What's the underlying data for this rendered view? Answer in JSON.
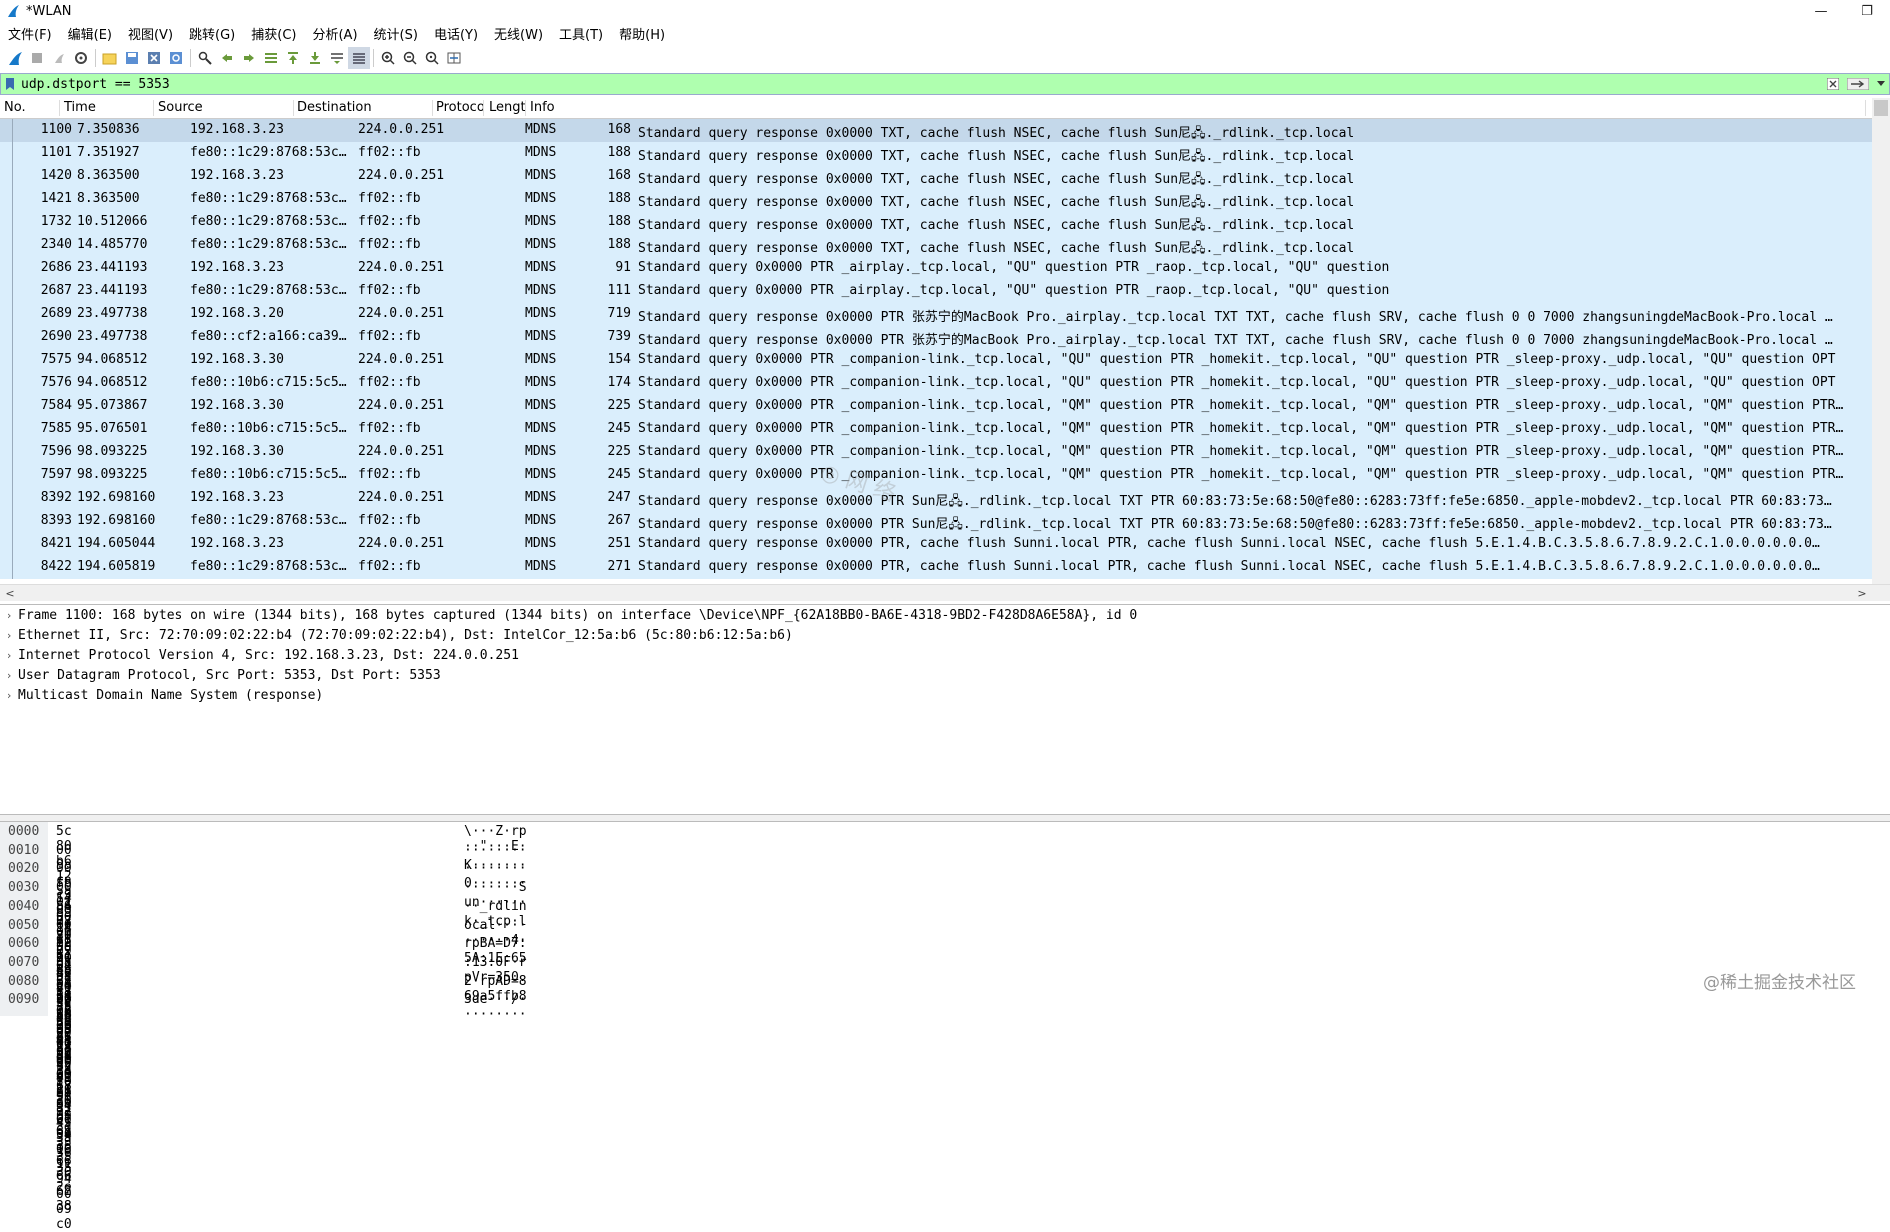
{
  "window": {
    "title": "*WLAN",
    "minimize": "—",
    "restore": "❐"
  },
  "menu": [
    "文件(F)",
    "编辑(E)",
    "视图(V)",
    "跳转(G)",
    "捕获(C)",
    "分析(A)",
    "统计(S)",
    "电话(Y)",
    "无线(W)",
    "工具(T)",
    "帮助(H)"
  ],
  "filter": {
    "value": "udp.dstport == 5353"
  },
  "columns": [
    "No.",
    "Time",
    "Source",
    "Destination",
    "Protoco",
    "Lengt",
    "Info"
  ],
  "packets": [
    {
      "no": "1100",
      "time": "7.350836",
      "src": "192.168.3.23",
      "dst": "224.0.0.251",
      "proto": "MDNS",
      "len": "168",
      "info": "Standard query response 0x0000 TXT, cache flush NSEC, cache flush Sun尼🖧._rdlink._tcp.local"
    },
    {
      "no": "1101",
      "time": "7.351927",
      "src": "fe80::1c29:8768:53c…",
      "dst": "ff02::fb",
      "proto": "MDNS",
      "len": "188",
      "info": "Standard query response 0x0000 TXT, cache flush NSEC, cache flush Sun尼🖧._rdlink._tcp.local"
    },
    {
      "no": "1420",
      "time": "8.363500",
      "src": "192.168.3.23",
      "dst": "224.0.0.251",
      "proto": "MDNS",
      "len": "168",
      "info": "Standard query response 0x0000 TXT, cache flush NSEC, cache flush Sun尼🖧._rdlink._tcp.local"
    },
    {
      "no": "1421",
      "time": "8.363500",
      "src": "fe80::1c29:8768:53c…",
      "dst": "ff02::fb",
      "proto": "MDNS",
      "len": "188",
      "info": "Standard query response 0x0000 TXT, cache flush NSEC, cache flush Sun尼🖧._rdlink._tcp.local"
    },
    {
      "no": "1732",
      "time": "10.512066",
      "src": "fe80::1c29:8768:53c…",
      "dst": "ff02::fb",
      "proto": "MDNS",
      "len": "188",
      "info": "Standard query response 0x0000 TXT, cache flush NSEC, cache flush Sun尼🖧._rdlink._tcp.local"
    },
    {
      "no": "2340",
      "time": "14.485770",
      "src": "fe80::1c29:8768:53c…",
      "dst": "ff02::fb",
      "proto": "MDNS",
      "len": "188",
      "info": "Standard query response 0x0000 TXT, cache flush NSEC, cache flush Sun尼🖧._rdlink._tcp.local"
    },
    {
      "no": "2686",
      "time": "23.441193",
      "src": "192.168.3.23",
      "dst": "224.0.0.251",
      "proto": "MDNS",
      "len": "91",
      "info": "Standard query 0x0000 PTR _airplay._tcp.local, \"QU\" question PTR _raop._tcp.local, \"QU\" question"
    },
    {
      "no": "2687",
      "time": "23.441193",
      "src": "fe80::1c29:8768:53c…",
      "dst": "ff02::fb",
      "proto": "MDNS",
      "len": "111",
      "info": "Standard query 0x0000 PTR _airplay._tcp.local, \"QU\" question PTR _raop._tcp.local, \"QU\" question"
    },
    {
      "no": "2689",
      "time": "23.497738",
      "src": "192.168.3.20",
      "dst": "224.0.0.251",
      "proto": "MDNS",
      "len": "719",
      "info": "Standard query response 0x0000 PTR 张苏宁的MacBook Pro._airplay._tcp.local TXT TXT, cache flush SRV, cache flush 0 0 7000 zhangsuningdeMacBook-Pro.local …"
    },
    {
      "no": "2690",
      "time": "23.497738",
      "src": "fe80::cf2:a166:ca39…",
      "dst": "ff02::fb",
      "proto": "MDNS",
      "len": "739",
      "info": "Standard query response 0x0000 PTR 张苏宁的MacBook Pro._airplay._tcp.local TXT TXT, cache flush SRV, cache flush 0 0 7000 zhangsuningdeMacBook-Pro.local …"
    },
    {
      "no": "7575",
      "time": "94.068512",
      "src": "192.168.3.30",
      "dst": "224.0.0.251",
      "proto": "MDNS",
      "len": "154",
      "info": "Standard query 0x0000 PTR _companion-link._tcp.local, \"QU\" question PTR _homekit._tcp.local, \"QU\" question PTR _sleep-proxy._udp.local, \"QU\" question OPT"
    },
    {
      "no": "7576",
      "time": "94.068512",
      "src": "fe80::10b6:c715:5c5…",
      "dst": "ff02::fb",
      "proto": "MDNS",
      "len": "174",
      "info": "Standard query 0x0000 PTR _companion-link._tcp.local, \"QU\" question PTR _homekit._tcp.local, \"QU\" question PTR _sleep-proxy._udp.local, \"QU\" question OPT"
    },
    {
      "no": "7584",
      "time": "95.073867",
      "src": "192.168.3.30",
      "dst": "224.0.0.251",
      "proto": "MDNS",
      "len": "225",
      "info": "Standard query 0x0000 PTR _companion-link._tcp.local, \"QM\" question PTR _homekit._tcp.local, \"QM\" question PTR _sleep-proxy._udp.local, \"QM\" question PTR…"
    },
    {
      "no": "7585",
      "time": "95.076501",
      "src": "fe80::10b6:c715:5c5…",
      "dst": "ff02::fb",
      "proto": "MDNS",
      "len": "245",
      "info": "Standard query 0x0000 PTR _companion-link._tcp.local, \"QM\" question PTR _homekit._tcp.local, \"QM\" question PTR _sleep-proxy._udp.local, \"QM\" question PTR…"
    },
    {
      "no": "7596",
      "time": "98.093225",
      "src": "192.168.3.30",
      "dst": "224.0.0.251",
      "proto": "MDNS",
      "len": "225",
      "info": "Standard query 0x0000 PTR _companion-link._tcp.local, \"QM\" question PTR _homekit._tcp.local, \"QM\" question PTR _sleep-proxy._udp.local, \"QM\" question PTR…"
    },
    {
      "no": "7597",
      "time": "98.093225",
      "src": "fe80::10b6:c715:5c5…",
      "dst": "ff02::fb",
      "proto": "MDNS",
      "len": "245",
      "info": "Standard query 0x0000 PTR _companion-link._tcp.local, \"QM\" question PTR _homekit._tcp.local, \"QM\" question PTR _sleep-proxy._udp.local, \"QM\" question PTR…"
    },
    {
      "no": "8392",
      "time": "192.698160",
      "src": "192.168.3.23",
      "dst": "224.0.0.251",
      "proto": "MDNS",
      "len": "247",
      "info": "Standard query response 0x0000 PTR Sun尼🖧._rdlink._tcp.local TXT PTR 60:83:73:5e:68:50@fe80::6283:73ff:fe5e:6850._apple-mobdev2._tcp.local PTR 60:83:73…"
    },
    {
      "no": "8393",
      "time": "192.698160",
      "src": "fe80::1c29:8768:53c…",
      "dst": "ff02::fb",
      "proto": "MDNS",
      "len": "267",
      "info": "Standard query response 0x0000 PTR Sun尼🖧._rdlink._tcp.local TXT PTR 60:83:73:5e:68:50@fe80::6283:73ff:fe5e:6850._apple-mobdev2._tcp.local PTR 60:83:73…"
    },
    {
      "no": "8421",
      "time": "194.605044",
      "src": "192.168.3.23",
      "dst": "224.0.0.251",
      "proto": "MDNS",
      "len": "251",
      "info": "Standard query response 0x0000 PTR, cache flush Sunni.local PTR, cache flush Sunni.local NSEC, cache flush 5.E.1.4.B.C.3.5.8.6.7.8.9.2.C.1.0.0.0.0.0.0…"
    },
    {
      "no": "8422",
      "time": "194.605819",
      "src": "fe80::1c29:8768:53c…",
      "dst": "ff02::fb",
      "proto": "MDNS",
      "len": "271",
      "info": "Standard query response 0x0000 PTR, cache flush Sunni.local PTR, cache flush Sunni.local NSEC, cache flush 5.E.1.4.B.C.3.5.8.6.7.8.9.2.C.1.0.0.0.0.0.0…"
    }
  ],
  "details": [
    "Frame 1100: 168 bytes on wire (1344 bits), 168 bytes captured (1344 bits) on interface \\Device\\NPF_{62A18BB0-BA6E-4318-9BD2-F428D8A6E58A}, id 0",
    "Ethernet II, Src: 72:70:09:02:22:b4 (72:70:09:02:22:b4), Dst: IntelCor_12:5a:b6 (5c:80:b6:12:5a:b6)",
    "Internet Protocol Version 4, Src: 192.168.3.23, Dst: 224.0.0.251",
    "User Datagram Protocol, Src Port: 5353, Dst Port: 5353",
    "Multicast Domain Name System (response)"
  ],
  "hex": [
    {
      "off": "0000",
      "bytes": "5c 80 b6 12 5a b6 72 70  09 02 22 b4 08 00 45 00",
      "ascii": "\\···Z·rp ··\"···E·"
    },
    {
      "off": "0010",
      "bytes": "00 9a ca c3 00 00 ff 11  4b d4 c0 a8 03 17 e0 00",
      "ascii": "········ K·······"
    },
    {
      "off": "0020",
      "bytes": "00 fb 14 e9 14 e9 00 86  30 cc 00 00 84 00 00 00",
      "ascii": "········ 0·······"
    },
    {
      "off": "0030",
      "bytes": "00 01 00 00 00 01 0a 53  75 6e e5 b0 bc f0 9f 92",
      "ascii": "·······S un······"
    },
    {
      "off": "0040",
      "bytes": "a4 07 5f 72 64 6c 69 6e  6b 04 5f 74 63 70 05 6c",
      "ascii": "··_rdlin k·_tcp·l"
    },
    {
      "off": "0050",
      "bytes": "6f 63 61 6c 00 00 10 80  01 00 00 11 94 00 34 16",
      "ascii": "ocal···· ······4·"
    },
    {
      "off": "0060",
      "bytes": "72 70 42 41 3d 44 37 3a  35 41 3a 31 45 3a 36 35",
      "ascii": "rpBA=D7: 5A:1E:65"
    },
    {
      "off": "0070",
      "bytes": "3a 31 33 3a 30 46 0a 72  70 56 72 3d 33 35 30 2e",
      "ascii": ":13:0F·r pVr=350."
    },
    {
      "off": "0080",
      "bytes": "32 11 72 70 41 44 3d 38  36 39 61 35 66 66 62 38",
      "ascii": "2·rpAD=8 69a5ffb8"
    },
    {
      "off": "0090",
      "bytes": "33 64 65 c0 0c 00 2f 80  01 00 00 11 94 00 09 c0",
      "ascii": "3de···/· ········"
    }
  ],
  "watermark": "@稀土掘金技术社区",
  "colors": {
    "filter_bg": "#afffaf",
    "row_bg": "#daeefc",
    "row_selected": "#c4d8ea"
  }
}
